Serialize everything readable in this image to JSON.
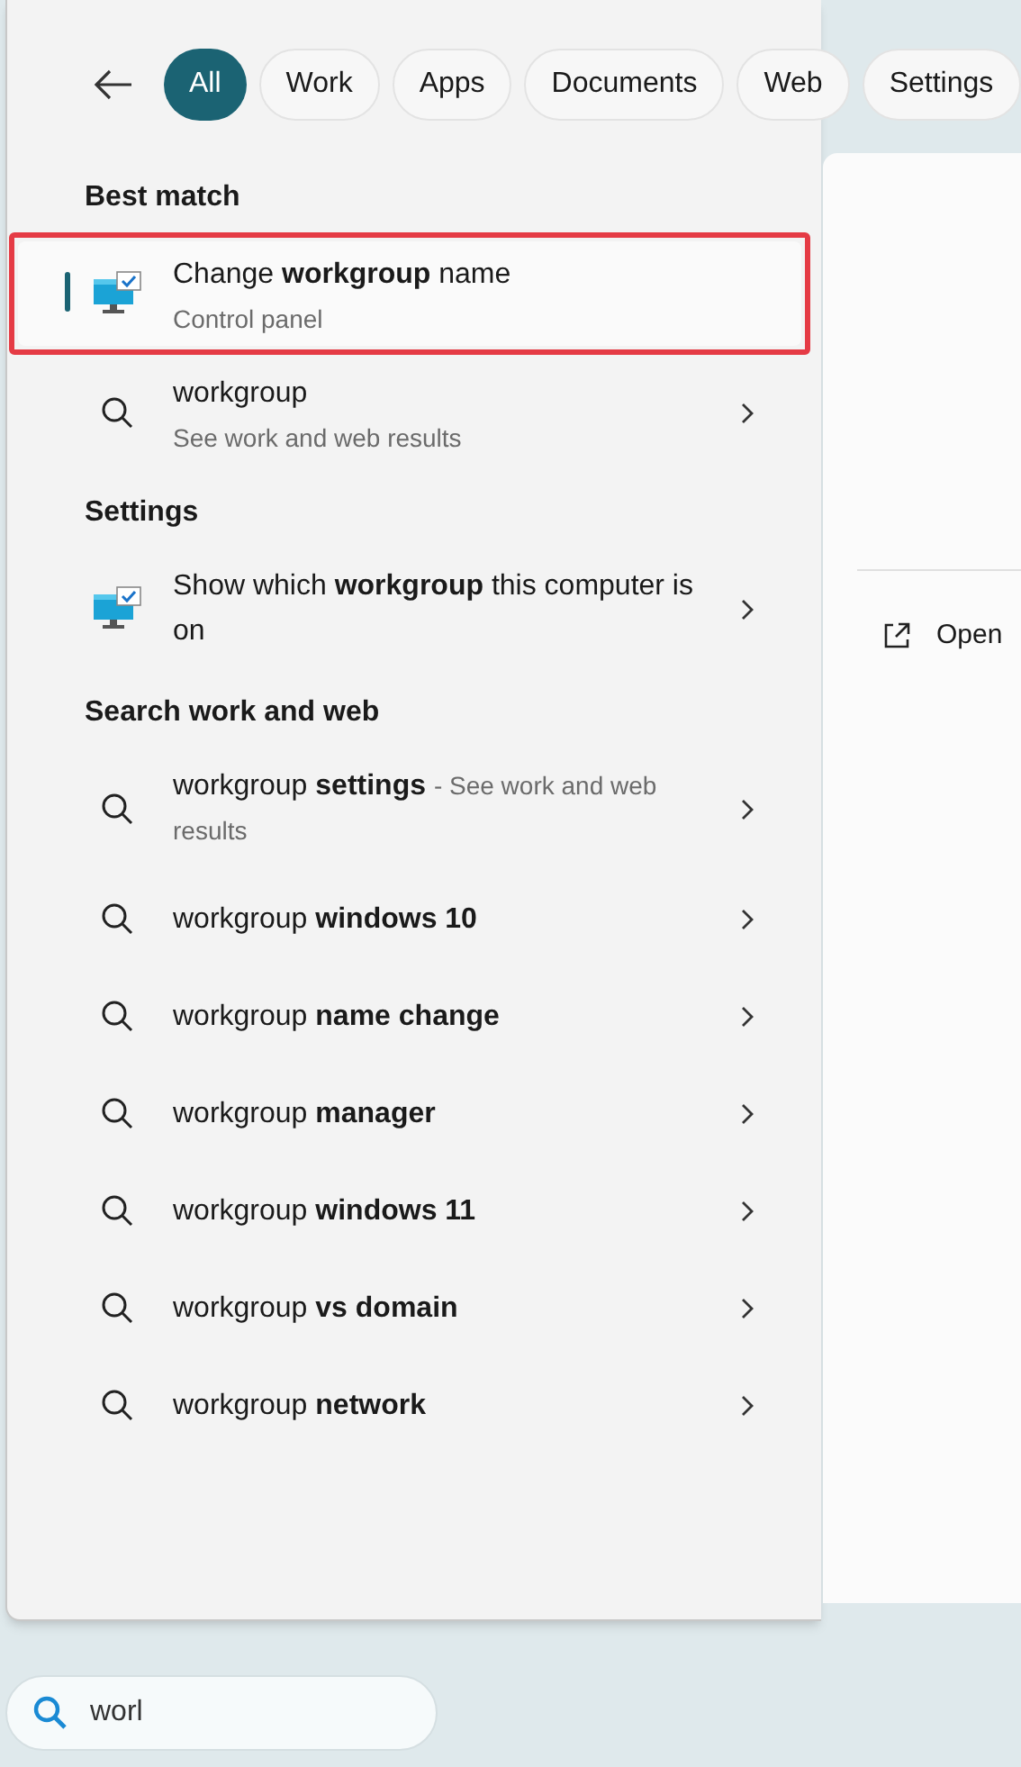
{
  "filters": [
    {
      "label": "All",
      "selected": true
    },
    {
      "label": "Work",
      "selected": false
    },
    {
      "label": "Apps",
      "selected": false
    },
    {
      "label": "Documents",
      "selected": false
    },
    {
      "label": "Web",
      "selected": false
    },
    {
      "label": "Settings",
      "selected": false
    }
  ],
  "sections": [
    {
      "title": "Best match",
      "items": [
        {
          "kind": "app",
          "title": "Change **workgroup** name",
          "subtitle": "Control panel",
          "selected": true,
          "outlined": true
        }
      ]
    },
    {
      "items": [
        {
          "kind": "search",
          "title": "workgroup",
          "subtitle": "See work and web results",
          "selected": false,
          "outlined": false
        }
      ]
    },
    {
      "title": "Settings",
      "items": [
        {
          "kind": "app",
          "title": "Show which **workgroup** this computer is on",
          "selected": false,
          "outlined": false
        }
      ]
    },
    {
      "title": "Search work and web",
      "items": [
        {
          "kind": "search",
          "title": "workgroup **settings**",
          "suffix": "- See work and web results",
          "selected": false,
          "outlined": false
        },
        {
          "kind": "search",
          "title": "workgroup **windows 10**",
          "selected": false,
          "outlined": false
        },
        {
          "kind": "search",
          "title": "workgroup **name change**",
          "selected": false,
          "outlined": false
        },
        {
          "kind": "search",
          "title": "workgroup **manager**",
          "selected": false,
          "outlined": false
        },
        {
          "kind": "search",
          "title": "workgroup **windows 11**",
          "selected": false,
          "outlined": false
        },
        {
          "kind": "search",
          "title": "workgroup **vs domain**",
          "selected": false,
          "outlined": false
        },
        {
          "kind": "search",
          "title": "workgroup **network**",
          "selected": false,
          "outlined": false
        }
      ]
    }
  ],
  "preview": {
    "action": "Open"
  },
  "taskbar": {
    "search_value": "worl"
  }
}
